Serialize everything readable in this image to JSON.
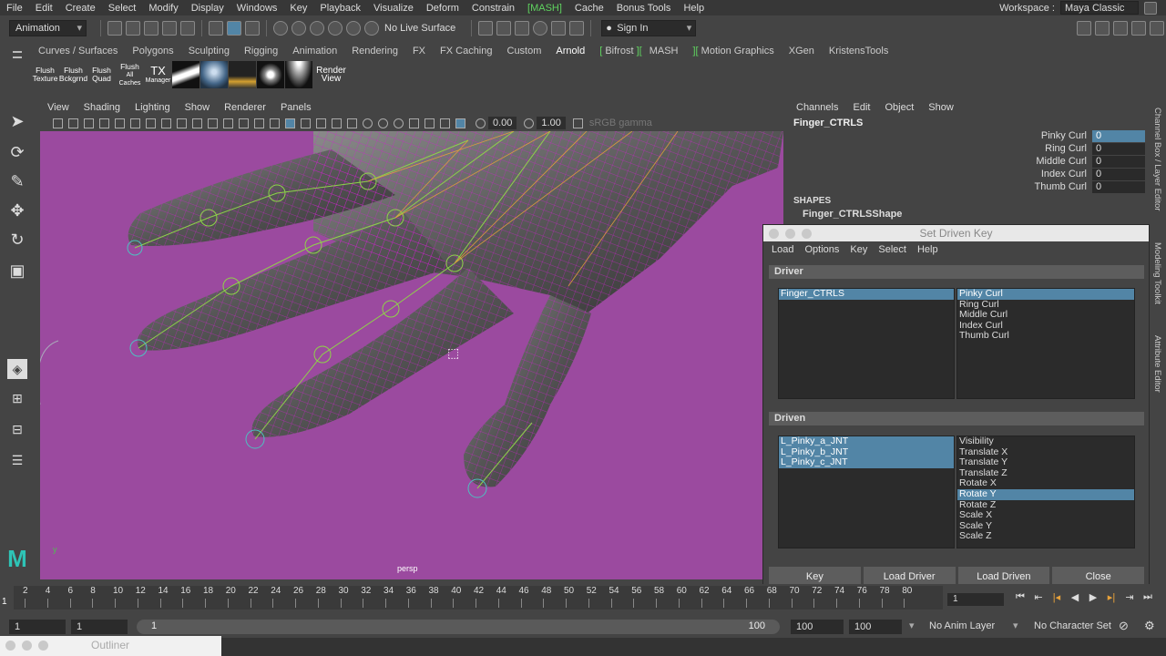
{
  "menubar": {
    "items": [
      "File",
      "Edit",
      "Create",
      "Select",
      "Modify",
      "Display",
      "Windows",
      "Key",
      "Playback",
      "Visualize",
      "Deform",
      "Constrain",
      "MASH",
      "Cache",
      "Bonus Tools",
      "Help"
    ],
    "workspace_label": "Workspace :",
    "workspace_value": "Maya Classic"
  },
  "statusline": {
    "mode": "Animation",
    "live_surface": "No Live Surface",
    "sign_in": "Sign In"
  },
  "shelf": {
    "tabs": [
      "Curves / Surfaces",
      "Polygons",
      "Sculpting",
      "Rigging",
      "Animation",
      "Rendering",
      "FX",
      "FX Caching",
      "Custom",
      "Arnold",
      "Bifrost",
      "MASH",
      "Motion Graphics",
      "XGen",
      "KristensTools"
    ],
    "active_tab": "Arnold",
    "buttons": [
      {
        "l1": "Flush",
        "l2": "Texture"
      },
      {
        "l1": "Flush",
        "l2": "Bckgrnd"
      },
      {
        "l1": "Flush",
        "l2": "Quad"
      },
      {
        "l1": "Flush",
        "l2": "All Caches"
      },
      {
        "l1": "TX",
        "l2": "Manager"
      }
    ],
    "render_view": {
      "l1": "Render",
      "l2": "View"
    }
  },
  "viewport": {
    "menu": [
      "View",
      "Shading",
      "Lighting",
      "Show",
      "Renderer",
      "Panels"
    ],
    "exposure": "0.00",
    "gamma": "1.00",
    "color_space": "sRGB gamma",
    "camera": "persp"
  },
  "channel_box": {
    "menu": [
      "Channels",
      "Edit",
      "Object",
      "Show"
    ],
    "object": "Finger_CTRLS",
    "attributes": [
      {
        "name": "Pinky Curl",
        "value": "0"
      },
      {
        "name": "Ring Curl",
        "value": "0"
      },
      {
        "name": "Middle Curl",
        "value": "0"
      },
      {
        "name": "Index Curl",
        "value": "0"
      },
      {
        "name": "Thumb Curl",
        "value": "0"
      }
    ],
    "shapes_label": "SHAPES",
    "shape_name": "Finger_CTRLSShape"
  },
  "side_tabs": [
    "Channel Box / Layer Editor",
    "Modeling Toolkit",
    "Attribute Editor"
  ],
  "set_driven_key": {
    "title": "Set Driven Key",
    "menu": [
      "Load",
      "Options",
      "Key",
      "Select",
      "Help"
    ],
    "driver_label": "Driver",
    "driver_objects": [
      "Finger_CTRLS"
    ],
    "driver_attrs": [
      "Pinky Curl",
      "Ring Curl",
      "Middle Curl",
      "Index Curl",
      "Thumb Curl"
    ],
    "driven_label": "Driven",
    "driven_objects": [
      "L_Pinky_a_JNT",
      "L_Pinky_b_JNT",
      "L_Pinky_c_JNT"
    ],
    "driven_attrs": [
      "Visibility",
      "Translate X",
      "Translate Y",
      "Translate Z",
      "Rotate X",
      "Rotate Y",
      "Rotate Z",
      "Scale X",
      "Scale Y",
      "Scale Z"
    ],
    "selected_driven_attr": "Rotate Y",
    "buttons": {
      "key": "Key",
      "load_driver": "Load Driver",
      "load_driven": "Load Driven",
      "close": "Close"
    }
  },
  "timeline": {
    "ticks": [
      "2",
      "4",
      "6",
      "8",
      "10",
      "12",
      "14",
      "16",
      "18",
      "20",
      "22",
      "24",
      "26",
      "28",
      "30",
      "32",
      "34",
      "36",
      "38",
      "40",
      "42",
      "44",
      "46",
      "48",
      "50",
      "52",
      "54",
      "56",
      "58",
      "60",
      "62",
      "64",
      "66",
      "68",
      "70",
      "72",
      "74",
      "76",
      "78",
      "80"
    ],
    "current": "1",
    "frame_field": "1"
  },
  "range": {
    "start": "1",
    "anim_start": "1",
    "slider_start": "1",
    "slider_end": "100",
    "anim_end": "100",
    "end": "100",
    "anim_layer": "No Anim Layer",
    "char_set": "No Character Set"
  },
  "outliner": {
    "title": "Outliner"
  }
}
